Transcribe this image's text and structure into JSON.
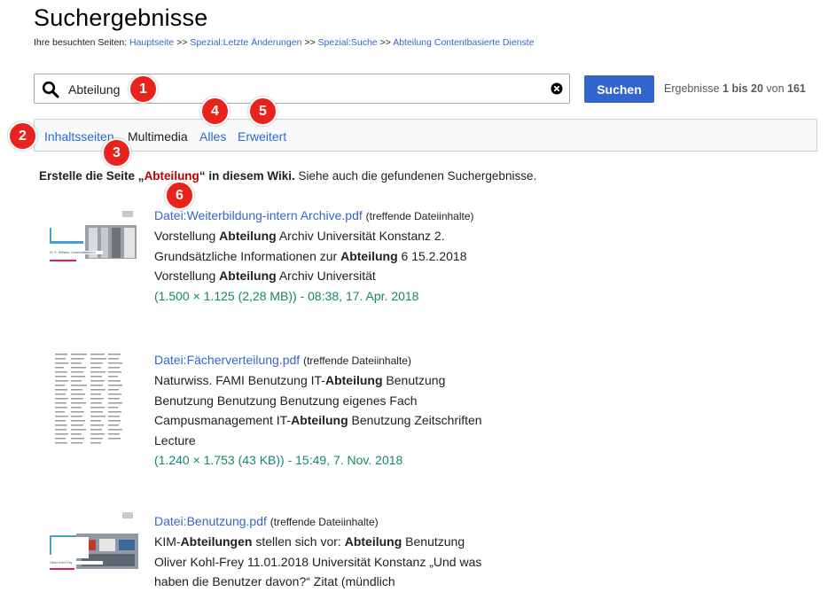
{
  "page": {
    "title": "Suchergebnisse",
    "breadcrumb_prefix": "Ihre besuchten Seiten:",
    "breadcrumb_sep": ">>",
    "breadcrumbs": [
      "Hauptseite",
      "Spezial:Letzte Änderungen",
      "Spezial:Suche",
      "Abteilung Contentbasierte Dienste"
    ]
  },
  "search": {
    "value": "Abteilung",
    "button_label": "Suchen",
    "results_prefix": "Ergebnisse",
    "results_range": "1 bis 20",
    "results_of": "von",
    "results_total": "161"
  },
  "profiles": {
    "tabs": [
      "Inhaltsseiten",
      "Multimedia",
      "Alles",
      "Erweitert"
    ],
    "active": "Multimedia"
  },
  "create": {
    "prefix": "Erstelle die Seite „",
    "term": "Abteilung",
    "suffix": "“ in diesem Wiki.",
    "see_also": "Siehe auch die gefundenen Suchergebnisse."
  },
  "results": [
    {
      "title": "Datei:Weiterbildung-intern Archive.pdf",
      "type": "(treffende Dateiinhalte)",
      "snippet_lines": [
        [
          [
            "Vorstellung ",
            false
          ],
          [
            "Abteilung",
            true
          ],
          [
            " Archiv Universität Konstanz 2.",
            false
          ]
        ],
        [
          [
            "Grundsätzliche Informationen zur ",
            false
          ],
          [
            "Abteilung",
            true
          ],
          [
            " 6 15.2.2018",
            false
          ]
        ],
        [
          [
            "Vorstellung ",
            false
          ],
          [
            "Abteilung",
            true
          ],
          [
            " Archiv Universität",
            false
          ]
        ]
      ],
      "meta": "(1.500 × 1.125 (2,28 MB)) - 08:38, 17. Apr. 2018"
    },
    {
      "title": "Datei:Fächerverteilung.pdf",
      "type": "(treffende Dateiinhalte)",
      "snippet_lines": [
        [
          [
            "Naturwiss. FAMI Benutzung IT-",
            false
          ],
          [
            "Abteilung",
            true
          ],
          [
            " Benutzung",
            false
          ]
        ],
        [
          [
            "Benutzung Benutzung Benutzung eigenes Fach",
            false
          ]
        ],
        [
          [
            "Campusmanagement IT-",
            false
          ],
          [
            "Abteilung",
            true
          ],
          [
            " Benutzung Zeitschriften",
            false
          ]
        ],
        [
          [
            "Lecture",
            false
          ]
        ]
      ],
      "meta": "(1.240 × 1.753 (43 KB)) - 15:49, 7. Nov. 2018"
    },
    {
      "title": "Datei:Benutzung.pdf",
      "type": "(treffende Dateiinhalte)",
      "snippet_lines": [
        [
          [
            "KIM-",
            false
          ],
          [
            "Abteilungen",
            true
          ],
          [
            " stellen sich vor: ",
            false
          ],
          [
            "Abteilung",
            true
          ],
          [
            " Benutzung",
            false
          ]
        ],
        [
          [
            "Oliver Kohl-Frey 11.01.2018 Universität Konstanz „Und was",
            false
          ]
        ],
        [
          [
            "haben die Benutzer davon?“ Zitat (mündlich",
            false
          ]
        ]
      ],
      "meta": ""
    }
  ],
  "thumbs": {
    "t1_title_lines": [
      "Vorstellung",
      "Abteilung",
      "Archiv"
    ],
    "t1_author": "Dr. E. Wilhelm, Universitätsarchiv",
    "t3_title_lines": [
      "KIM-Abteilungen",
      "stellen sich vor:",
      "Abteilung Benutzung"
    ],
    "t3_author": "Oliver Kohl-Frey"
  },
  "callouts": [
    "1",
    "2",
    "3",
    "4",
    "5",
    "6"
  ],
  "colors": {
    "link": "#3366cc",
    "button": "#3366cc",
    "callout": "#e8231e",
    "meta": "#14866d",
    "red_link": "#ba0000"
  }
}
